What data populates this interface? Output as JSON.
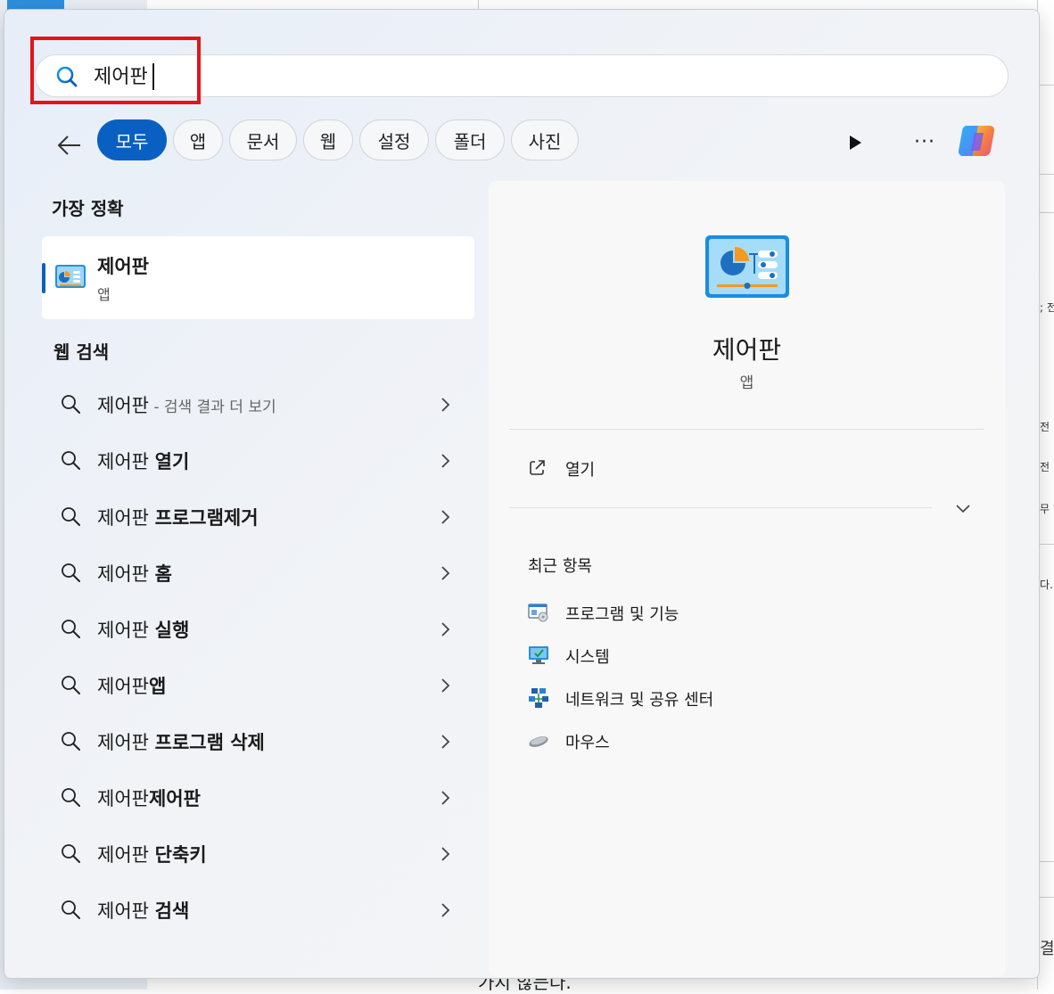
{
  "search": {
    "value": "제어판"
  },
  "filters": [
    "모두",
    "앱",
    "문서",
    "웹",
    "설정",
    "폴더",
    "사진"
  ],
  "more_label": "···",
  "best_match": {
    "heading": "가장 정확",
    "title": "제어판",
    "subtitle": "앱"
  },
  "web_search": {
    "heading": "웹 검색",
    "items": [
      {
        "prefix": "제어판",
        "bold": "",
        "dim": " - 검색 결과 더 보기"
      },
      {
        "prefix": "제어판 ",
        "bold": "열기",
        "dim": ""
      },
      {
        "prefix": "제어판 ",
        "bold": "프로그램제거",
        "dim": ""
      },
      {
        "prefix": "제어판 ",
        "bold": "홈",
        "dim": ""
      },
      {
        "prefix": "제어판 ",
        "bold": "실행",
        "dim": ""
      },
      {
        "prefix": "제어판",
        "bold": "앱",
        "dim": ""
      },
      {
        "prefix": "제어판 ",
        "bold": "프로그램 삭제",
        "dim": ""
      },
      {
        "prefix": "제어판",
        "bold": "제어판",
        "dim": ""
      },
      {
        "prefix": "제어판 ",
        "bold": "단축키",
        "dim": ""
      },
      {
        "prefix": "제어판 ",
        "bold": "검색",
        "dim": ""
      }
    ]
  },
  "preview": {
    "title": "제어판",
    "subtitle": "앱",
    "open_label": "열기",
    "recent_heading": "최근 항목",
    "recent": [
      {
        "label": "프로그램 및 기능",
        "icon": "programs-features-icon"
      },
      {
        "label": "시스템",
        "icon": "system-monitor-icon"
      },
      {
        "label": "네트워크 및 공유 센터",
        "icon": "network-sharing-icon"
      },
      {
        "label": "마우스",
        "icon": "mouse-icon"
      }
    ]
  },
  "background": {
    "bottom_text": "가지 않는다.",
    "right_texts": [
      "; 전",
      "전",
      "전",
      "무 ?",
      "다. I",
      "결"
    ]
  }
}
